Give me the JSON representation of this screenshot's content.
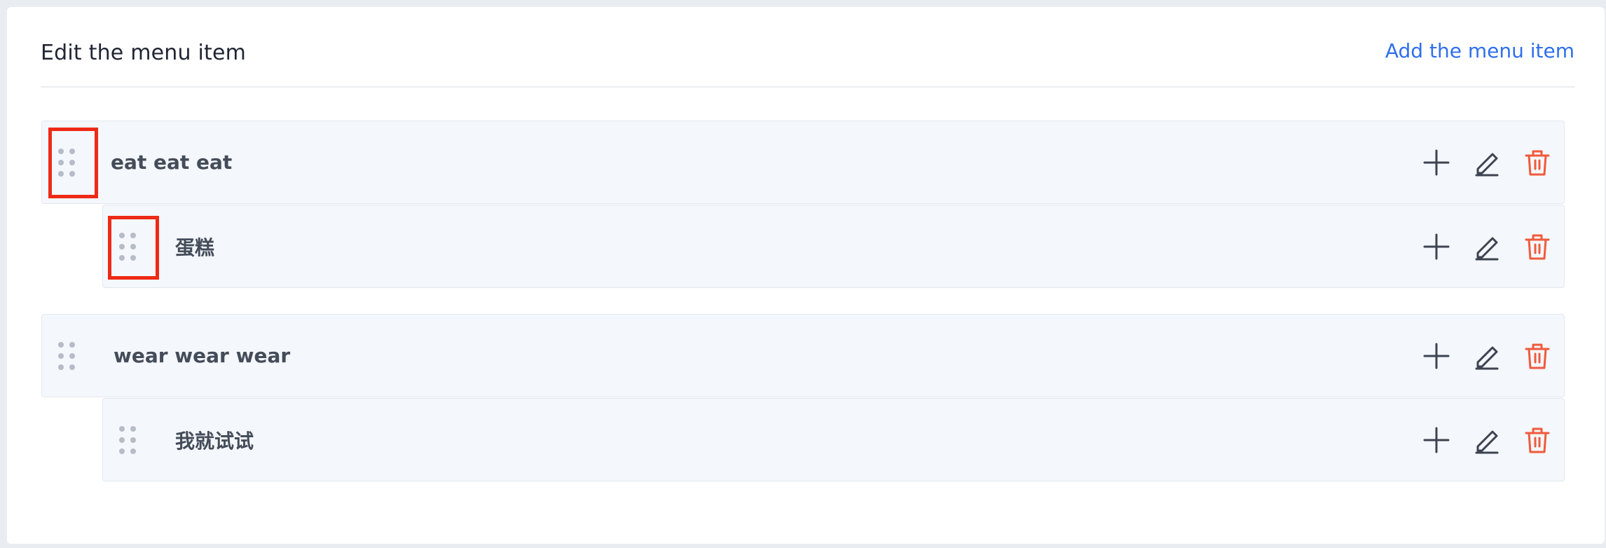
{
  "header": {
    "title": "Edit the menu item",
    "add_link": "Add the menu item"
  },
  "menu": {
    "items": [
      {
        "label": "eat eat eat",
        "level": 0,
        "children": [
          {
            "label": "蛋糕",
            "level": 1
          }
        ]
      },
      {
        "label": "wear wear wear",
        "level": 0,
        "children": [
          {
            "label": "我就试试",
            "level": 1
          }
        ]
      }
    ]
  },
  "icons": {
    "drag": "drag-handle-icon",
    "add": "plus-icon",
    "edit": "pencil-icon",
    "delete": "trash-icon"
  },
  "colors": {
    "accent": "#2f6fec",
    "delete": "#f05a3c",
    "action": "#3d4350",
    "highlight": "#ee2a17",
    "row_bg": "#f4f7fb"
  }
}
